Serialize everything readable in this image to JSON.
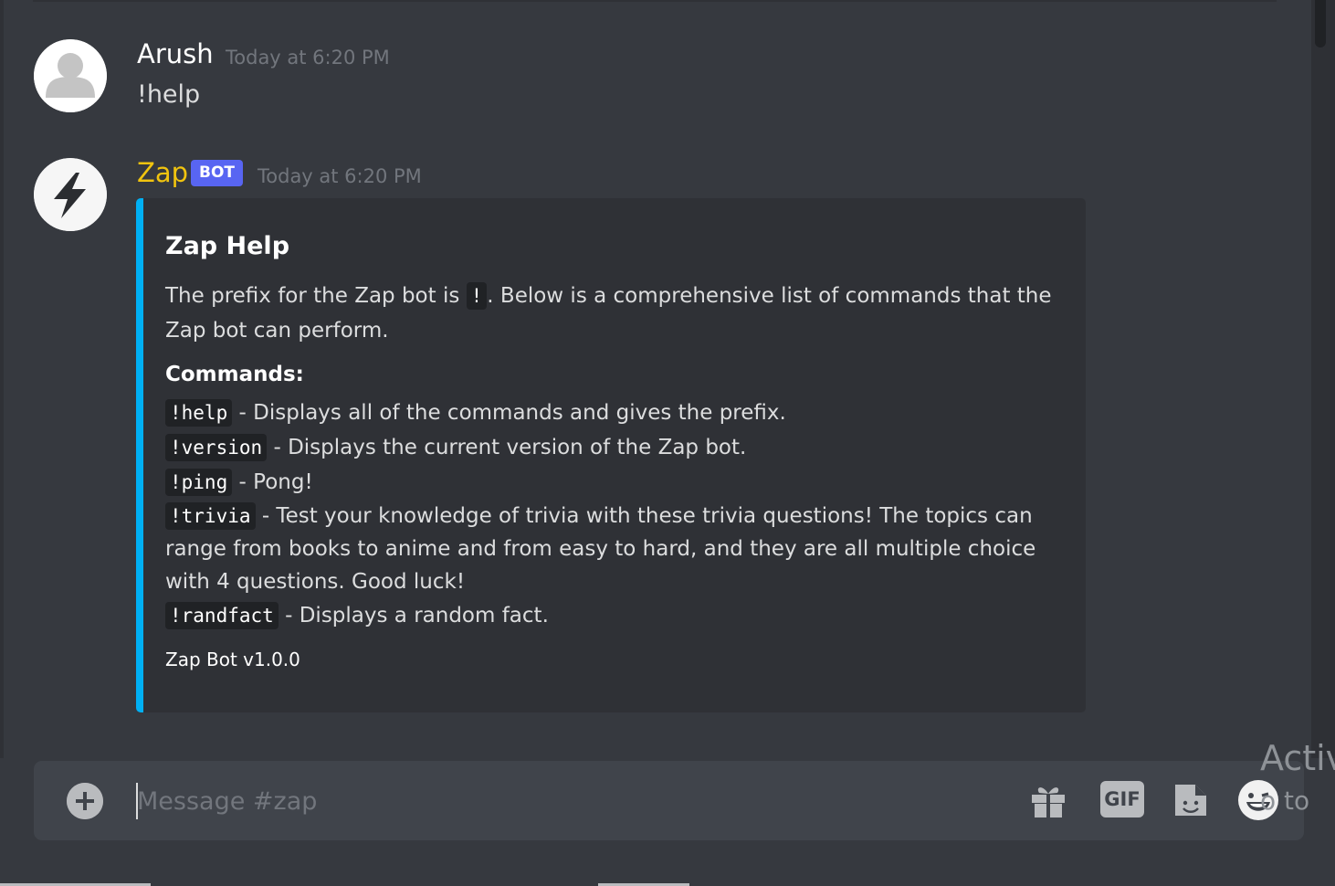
{
  "messages": [
    {
      "author": "Arush",
      "timestamp": "Today at 6:20 PM",
      "content": "!help",
      "author_color": "#ffffff",
      "avatar_icon": "default-user-icon"
    },
    {
      "author": "Zap",
      "bot_tag": "BOT",
      "timestamp": "Today at 6:20 PM",
      "author_color": "#f1c40f",
      "avatar_icon": "lightning-bolt-icon",
      "embed": {
        "accent_color": "#00b0f4",
        "title": "Zap Help",
        "description_before": "The prefix for the Zap bot is ",
        "prefix_code": "!",
        "description_after": ". Below is a comprehensive list of commands that the Zap bot can perform.",
        "commands_heading": "Commands:",
        "commands": [
          {
            "code": "!help",
            "desc": " - Displays all of the commands and gives the prefix."
          },
          {
            "code": "!version",
            "desc": " - Displays the current version of the Zap bot."
          },
          {
            "code": "!ping",
            "desc": " - Pong!"
          },
          {
            "code": "!trivia",
            "desc": " - Test your knowledge of trivia with these trivia questions! The topics can range from books to anime and from easy to hard, and they are all multiple choice with 4 questions. Good luck!"
          },
          {
            "code": "!randfact",
            "desc": " - Displays a random fact."
          }
        ],
        "footer": "Zap Bot v1.0.0"
      }
    }
  ],
  "composer": {
    "placeholder": "Message #zap",
    "gif_label": "GIF",
    "icons": [
      "add-circle-icon",
      "gift-icon",
      "gif-icon",
      "sticker-icon",
      "emoji-icon"
    ]
  },
  "watermark": {
    "line1": "Activ",
    "line2": "o to"
  }
}
